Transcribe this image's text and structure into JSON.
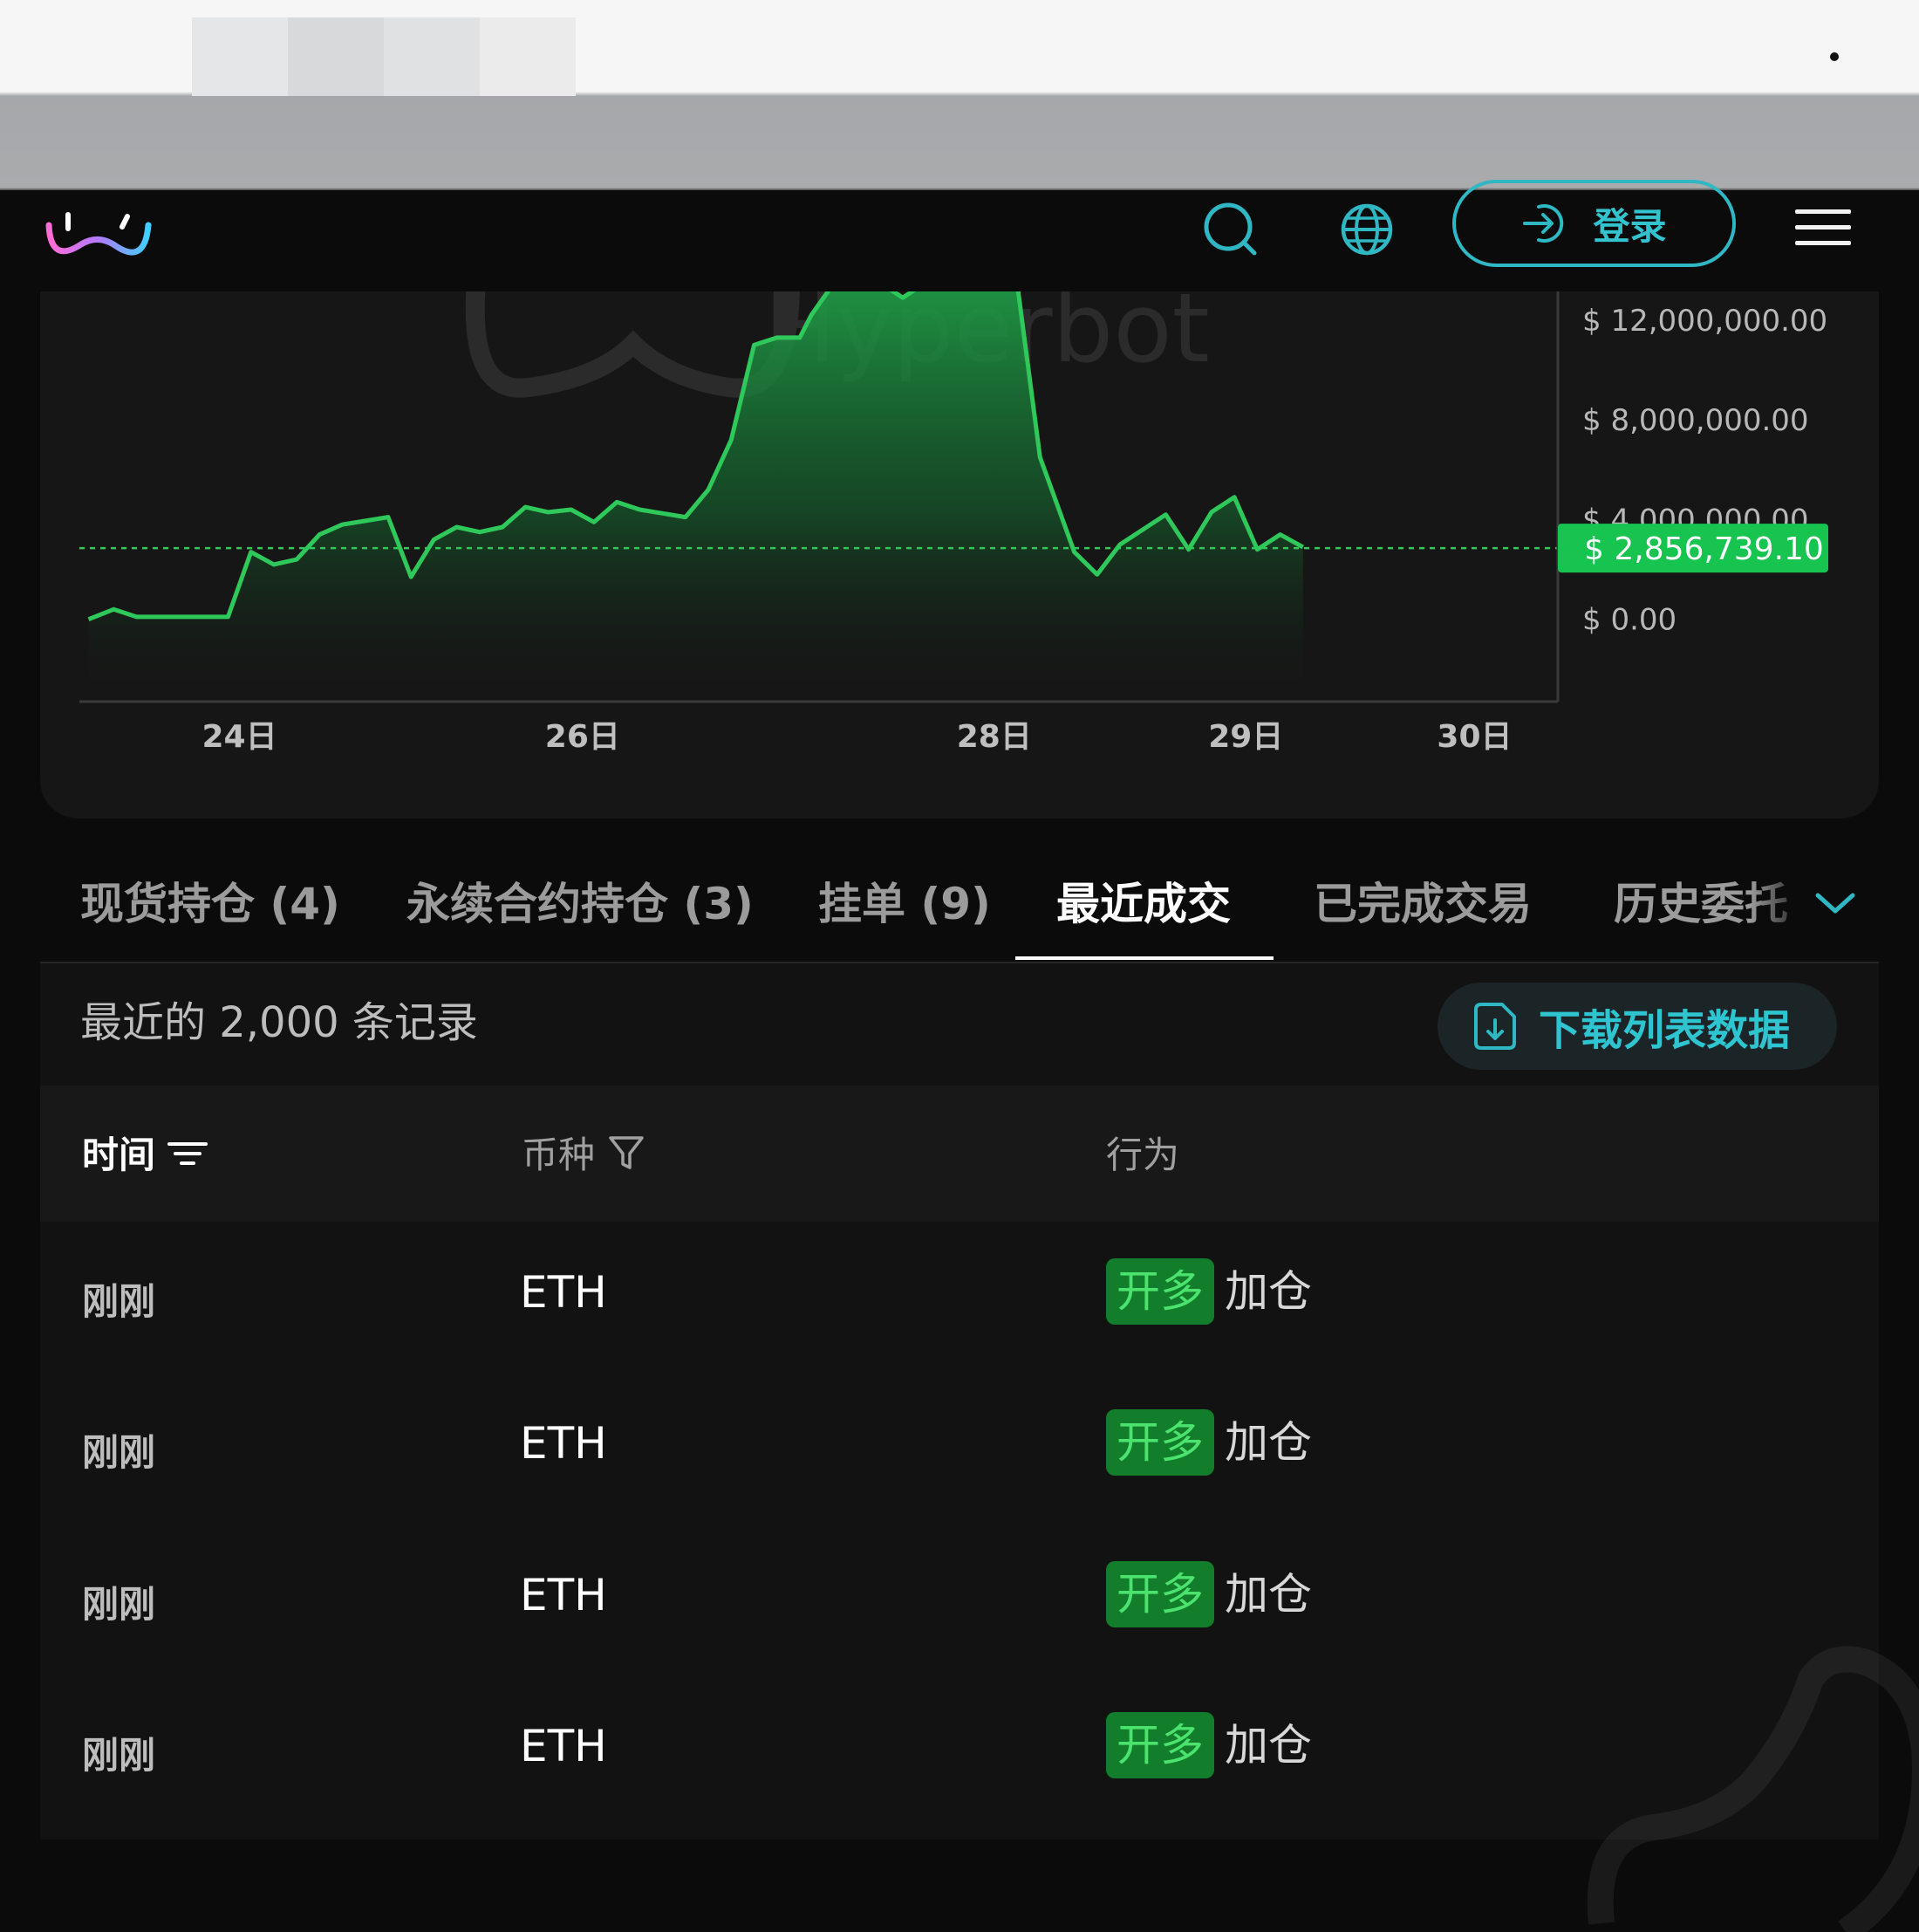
{
  "header": {
    "login_label": "登录",
    "icons": [
      "logo-icon",
      "search-icon",
      "globe-icon",
      "login-arrow-icon",
      "menu-icon"
    ]
  },
  "chart_data": {
    "type": "area",
    "watermark": "Hyperbot",
    "current_value_label": "$ 2,856,739.10",
    "current_value": 2856739.1,
    "y_tick_labels": [
      "$ 12,000,000.00",
      "$ 8,000,000.00",
      "$ 4,000,000.00",
      "$ 0.00"
    ],
    "y_ticks": [
      12000000,
      8000000,
      4000000,
      0
    ],
    "ylim": [
      -3300000,
      13500000
    ],
    "x_tick_labels": [
      "24日",
      "26日",
      "28日",
      "29日",
      "30日"
    ],
    "x_tick_positions": [
      7.0,
      22.0,
      40.0,
      51.0,
      61.0
    ],
    "xlim": [
      0,
      63.5
    ],
    "series": [
      {
        "values": [
          [
            0.4,
            0.0
          ],
          [
            1.5,
            0.4
          ],
          [
            2.5,
            0.1
          ],
          [
            6.5,
            0.1
          ],
          [
            7.5,
            2.7
          ],
          [
            8.5,
            2.2
          ],
          [
            9.5,
            2.4
          ],
          [
            10.5,
            3.4
          ],
          [
            11.5,
            3.8
          ],
          [
            13.5,
            4.1
          ],
          [
            14.5,
            1.7
          ],
          [
            15.5,
            3.2
          ],
          [
            16.5,
            3.7
          ],
          [
            17.5,
            3.5
          ],
          [
            18.5,
            3.7
          ],
          [
            19.5,
            4.5
          ],
          [
            20.5,
            4.3
          ],
          [
            21.5,
            4.4
          ],
          [
            22.5,
            3.9
          ],
          [
            23.5,
            4.7
          ],
          [
            24.5,
            4.4
          ],
          [
            26.5,
            4.1
          ],
          [
            27.5,
            5.2
          ],
          [
            28.5,
            7.2
          ],
          [
            29.5,
            11.0
          ],
          [
            30.5,
            11.3
          ],
          [
            31.5,
            11.3
          ],
          [
            32.0,
            12.2
          ],
          [
            33.0,
            13.5
          ],
          [
            35.0,
            13.5
          ],
          [
            36.0,
            12.9
          ],
          [
            37.0,
            13.5
          ],
          [
            38.5,
            13.5
          ],
          [
            39.5,
            13.5
          ],
          [
            40.5,
            13.5
          ],
          [
            41.0,
            13.5
          ],
          [
            42.0,
            6.5
          ],
          [
            43.5,
            2.7
          ],
          [
            44.5,
            1.8
          ],
          [
            45.5,
            3.0
          ],
          [
            47.5,
            4.2
          ],
          [
            48.5,
            2.8
          ],
          [
            49.5,
            4.3
          ],
          [
            50.5,
            4.9
          ],
          [
            51.5,
            2.8
          ],
          [
            52.5,
            3.4
          ],
          [
            53.5,
            2.9
          ]
        ],
        "value_unit": "USD millions"
      }
    ]
  },
  "tabs": [
    {
      "label": "现货持仓 (4)"
    },
    {
      "label": "永续合约持仓 (3)"
    },
    {
      "label": "挂单 (9)"
    },
    {
      "label": "最近成交"
    },
    {
      "label": "已完成交易"
    },
    {
      "label": "历史委托"
    }
  ],
  "active_tab": "最近成交",
  "records": {
    "count_label": "最近的 2,000 条记录",
    "download_label": "下载列表数据"
  },
  "table": {
    "columns": [
      "时间",
      "币种",
      "行为"
    ],
    "rows": [
      {
        "time": "刚刚",
        "coin": "ETH",
        "badge": "开多",
        "action": "加仓"
      },
      {
        "time": "刚刚",
        "coin": "ETH",
        "badge": "开多",
        "action": "加仓"
      },
      {
        "time": "刚刚",
        "coin": "ETH",
        "badge": "开多",
        "action": "加仓"
      },
      {
        "time": "刚刚",
        "coin": "ETH",
        "badge": "开多",
        "action": "加仓"
      }
    ]
  },
  "colors": {
    "accent_cyan": "#2fb7c4",
    "line_green": "#2ec95a",
    "badge_bg": "#127d2b",
    "badge_text": "#4be36e",
    "background": "#0b0b0b"
  }
}
